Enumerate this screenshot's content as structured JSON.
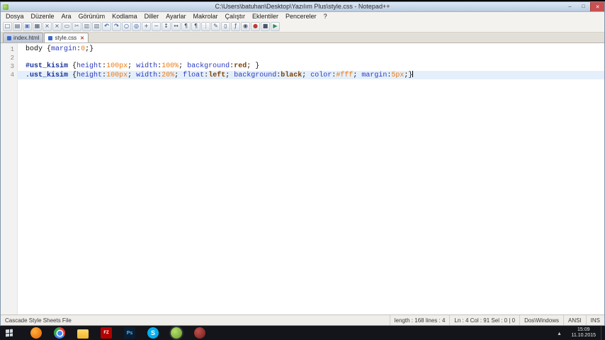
{
  "window": {
    "title": "C:\\Users\\batuhan\\Desktop\\Yazılım Plus\\style.css - Notepad++",
    "controls": {
      "minimize": "–",
      "maximize": "□",
      "close": "✕"
    }
  },
  "menu": {
    "items": [
      "Dosya",
      "Düzenle",
      "Ara",
      "Görünüm",
      "Kodlama",
      "Diller",
      "Ayarlar",
      "Makrolar",
      "Çalıştır",
      "Eklentiler",
      "Pencereler",
      "?"
    ]
  },
  "toolbar": {
    "icons": [
      {
        "name": "new-file-icon",
        "glyph": "□"
      },
      {
        "name": "open-file-icon",
        "glyph": "▤"
      },
      {
        "name": "save-icon",
        "glyph": "▣"
      },
      {
        "name": "save-all-icon",
        "glyph": "▦"
      },
      {
        "name": "close-file-icon",
        "glyph": "×"
      },
      {
        "name": "close-all-icon",
        "glyph": "×"
      },
      {
        "name": "print-icon",
        "glyph": "▭"
      },
      {
        "name": "cut-icon",
        "glyph": "✂"
      },
      {
        "name": "copy-icon",
        "glyph": "▥"
      },
      {
        "name": "paste-icon",
        "glyph": "▧"
      },
      {
        "name": "undo-icon",
        "glyph": "↶"
      },
      {
        "name": "redo-icon",
        "glyph": "↷"
      },
      {
        "name": "find-icon",
        "glyph": "○"
      },
      {
        "name": "replace-icon",
        "glyph": "◎"
      },
      {
        "name": "zoom-in-icon",
        "glyph": "+"
      },
      {
        "name": "zoom-out-icon",
        "glyph": "−"
      },
      {
        "name": "sync-vertical-icon",
        "glyph": "↕"
      },
      {
        "name": "sync-horizontal-icon",
        "glyph": "↔"
      },
      {
        "name": "word-wrap-icon",
        "glyph": "¶"
      },
      {
        "name": "show-all-characters-icon",
        "glyph": "¶"
      },
      {
        "name": "indent-guide-icon",
        "glyph": "⋮"
      },
      {
        "name": "user-defined-dialog-icon",
        "glyph": "✎"
      },
      {
        "name": "document-map-icon",
        "glyph": "▯"
      },
      {
        "name": "function-list-icon",
        "glyph": "ƒ"
      },
      {
        "name": "monitoring-icon",
        "glyph": "◉"
      },
      {
        "name": "record-macro-icon",
        "glyph": "●"
      },
      {
        "name": "stop-macro-icon",
        "glyph": "■"
      },
      {
        "name": "play-macro-icon",
        "glyph": "▶"
      }
    ]
  },
  "tabs": [
    {
      "label": "index.html",
      "active": false
    },
    {
      "label": "style.css",
      "active": true
    }
  ],
  "editor": {
    "current_line": 4,
    "lines": [
      {
        "number": 1,
        "tokens": [
          {
            "type": "plain",
            "text": "body "
          },
          {
            "type": "punc",
            "text": "{"
          },
          {
            "type": "prop",
            "text": "margin"
          },
          {
            "type": "punc",
            "text": ":"
          },
          {
            "type": "val",
            "text": "0"
          },
          {
            "type": "punc",
            "text": ";}"
          }
        ]
      },
      {
        "number": 2,
        "tokens": []
      },
      {
        "number": 3,
        "tokens": [
          {
            "type": "sel",
            "text": "#ust_kisim"
          },
          {
            "type": "punc",
            "text": " {"
          },
          {
            "type": "prop",
            "text": "height"
          },
          {
            "type": "punc",
            "text": ":"
          },
          {
            "type": "val",
            "text": "100px"
          },
          {
            "type": "punc",
            "text": "; "
          },
          {
            "type": "prop",
            "text": "width"
          },
          {
            "type": "punc",
            "text": ":"
          },
          {
            "type": "val",
            "text": "100%"
          },
          {
            "type": "punc",
            "text": "; "
          },
          {
            "type": "prop",
            "text": "background"
          },
          {
            "type": "punc",
            "text": ":"
          },
          {
            "type": "kw",
            "text": "red"
          },
          {
            "type": "punc",
            "text": "; }"
          }
        ]
      },
      {
        "number": 4,
        "tokens": [
          {
            "type": "sel",
            "text": ".ust_kisim"
          },
          {
            "type": "punc",
            "text": " {"
          },
          {
            "type": "prop",
            "text": "height"
          },
          {
            "type": "punc",
            "text": ":"
          },
          {
            "type": "val",
            "text": "100px"
          },
          {
            "type": "punc",
            "text": "; "
          },
          {
            "type": "prop",
            "text": "width"
          },
          {
            "type": "punc",
            "text": ":"
          },
          {
            "type": "val",
            "text": "20%"
          },
          {
            "type": "punc",
            "text": "; "
          },
          {
            "type": "prop",
            "text": "float"
          },
          {
            "type": "punc",
            "text": ":"
          },
          {
            "type": "kw",
            "text": "left"
          },
          {
            "type": "punc",
            "text": "; "
          },
          {
            "type": "prop",
            "text": "background"
          },
          {
            "type": "punc",
            "text": ":"
          },
          {
            "type": "kw",
            "text": "black"
          },
          {
            "type": "punc",
            "text": "; "
          },
          {
            "type": "prop",
            "text": "color"
          },
          {
            "type": "punc",
            "text": ":"
          },
          {
            "type": "val",
            "text": "#fff"
          },
          {
            "type": "punc",
            "text": "; "
          },
          {
            "type": "prop",
            "text": "margin"
          },
          {
            "type": "punc",
            "text": ":"
          },
          {
            "type": "val",
            "text": "5px"
          },
          {
            "type": "punc",
            "text": ";}"
          }
        ]
      }
    ]
  },
  "status": {
    "file_type": "Cascade Style Sheets File",
    "length_info": "length : 168    lines : 4",
    "caret_info": "Ln : 4    Col : 91    Sel : 0 | 0",
    "eol": "Dos\\Windows",
    "encoding": "ANSI",
    "mode": "INS"
  },
  "taskbar": {
    "apps": [
      {
        "kind": "firefox",
        "label": ""
      },
      {
        "kind": "chrome",
        "label": ""
      },
      {
        "kind": "folder",
        "label": ""
      },
      {
        "kind": "filezilla",
        "label": "FZ"
      },
      {
        "kind": "photoshop",
        "label": "Ps"
      },
      {
        "kind": "skype",
        "label": "S"
      },
      {
        "kind": "notepad-plus-plus",
        "label": ""
      },
      {
        "kind": "red-app",
        "label": ""
      }
    ],
    "tray": {
      "arrow": "▴",
      "time": "15:09",
      "date": "11.10.2015"
    }
  }
}
